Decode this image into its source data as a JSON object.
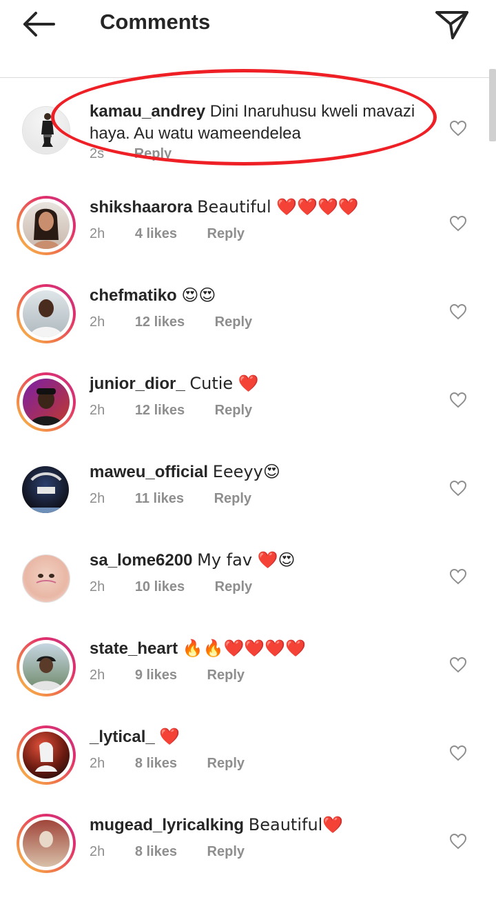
{
  "header": {
    "title": "Comments",
    "back_icon": "arrow-left-icon",
    "share_icon": "send-icon"
  },
  "colors": {
    "highlight": "#ee2026",
    "meta": "#8e8e8e",
    "text": "#262626"
  },
  "comments": [
    {
      "username": "kamau_andrey",
      "text": "Dini Inaruhusu kweli mavazi haya. Au watu wameendelea",
      "time": "2s",
      "likes": "",
      "reply": "Reply",
      "ring": false
    },
    {
      "username": "shikshaarora",
      "text": "Beautiful ❤️❤️❤️❤️",
      "time": "2h",
      "likes": "4 likes",
      "reply": "Reply",
      "ring": true
    },
    {
      "username": "chefmatiko",
      "text": "😍😍",
      "time": "2h",
      "likes": "12 likes",
      "reply": "Reply",
      "ring": true
    },
    {
      "username": "junior_dior_",
      "text": "Cutie ❤️",
      "time": "2h",
      "likes": "12 likes",
      "reply": "Reply",
      "ring": true
    },
    {
      "username": "maweu_official",
      "text": "Eeeyy😍",
      "time": "2h",
      "likes": "11 likes",
      "reply": "Reply",
      "ring": false
    },
    {
      "username": "sa_lome6200",
      "text": "My fav ❤️😍",
      "time": "2h",
      "likes": "10 likes",
      "reply": "Reply",
      "ring": false
    },
    {
      "username": "state_heart",
      "text": "🔥🔥❤️❤️❤️❤️",
      "time": "2h",
      "likes": "9 likes",
      "reply": "Reply",
      "ring": true
    },
    {
      "username": "_lytical_",
      "text": "❤️",
      "time": "2h",
      "likes": "8 likes",
      "reply": "Reply",
      "ring": true
    },
    {
      "username": "mugead_lyricalking",
      "text": "Beautiful❤️",
      "time": "2h",
      "likes": "8 likes",
      "reply": "Reply",
      "ring": true
    }
  ]
}
